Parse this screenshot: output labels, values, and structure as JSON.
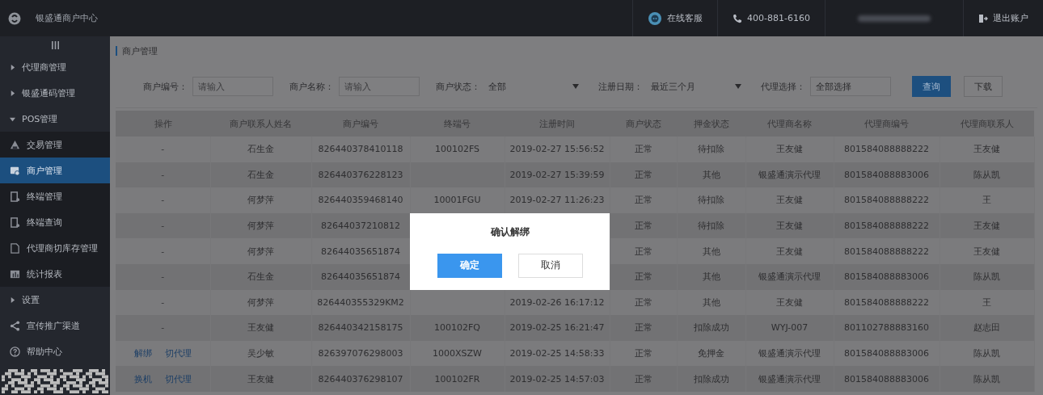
{
  "header": {
    "title": "银盛通商户中心",
    "service": "在线客服",
    "phone": "400-881-6160",
    "logout": "退出账户"
  },
  "sidebar": {
    "items": [
      {
        "kind": "group",
        "label": "代理商管理",
        "expanded": false
      },
      {
        "kind": "group",
        "label": "银盛通码管理",
        "expanded": false
      },
      {
        "kind": "group",
        "label": "POS管理",
        "expanded": true,
        "children": [
          {
            "label": "交易管理",
            "selected": false
          },
          {
            "label": "商户管理",
            "selected": true
          },
          {
            "label": "终端管理",
            "selected": false
          },
          {
            "label": "终端查询",
            "selected": false
          },
          {
            "label": "代理商切库存管理",
            "selected": false
          },
          {
            "label": "统计报表",
            "selected": false
          }
        ]
      },
      {
        "kind": "group",
        "label": "设置",
        "expanded": false
      },
      {
        "kind": "link",
        "label": "宣传推广渠道"
      },
      {
        "kind": "link",
        "label": "帮助中心"
      }
    ]
  },
  "breadcrumb": "商户管理",
  "filters": [
    {
      "kind": "input",
      "label": "商户编号：",
      "placeholder": "请输入"
    },
    {
      "kind": "input",
      "label": "商户名称：",
      "placeholder": "请输入"
    },
    {
      "kind": "select",
      "label": "商户状态：",
      "value": "全部"
    },
    {
      "kind": "select",
      "label": "注册日期：",
      "value": "最近三个月"
    },
    {
      "kind": "input",
      "label": "代理选择：",
      "value": "全部选择"
    }
  ],
  "buttons": [
    {
      "label": "查询",
      "primary": true
    },
    {
      "label": "下载",
      "primary": false
    }
  ],
  "table": {
    "columns": [
      "操作",
      "商户联系人姓名",
      "商户编号",
      "终端号",
      "注册时间",
      "商户状态",
      "押金状态",
      "代理商名称",
      "代理商编号",
      "代理商联系人"
    ],
    "rows": [
      {
        "cells": [
          "-",
          "石生金",
          "826440378410118",
          "100102FS",
          "2019-02-27 15:56:52",
          "正常",
          "待扣除",
          "王友健",
          "801584088888222",
          "王友健"
        ]
      },
      {
        "cells": [
          "-",
          "石生金",
          "826440376228123",
          "",
          "2019-02-27 15:39:59",
          "正常",
          "其他",
          "银盛通演示代理",
          "801584088883006",
          "陈从凯"
        ]
      },
      {
        "cells": [
          "-",
          "何梦萍",
          "826440359468140",
          "10001FGU",
          "2019-02-27 11:26:23",
          "正常",
          "待扣除",
          "王友健",
          "801584088888222",
          "王"
        ]
      },
      {
        "cells": [
          "-",
          "何梦萍",
          "82644037210812",
          "",
          "",
          "正常",
          "待扣除",
          "王友健",
          "801584088888222",
          "王友健"
        ]
      },
      {
        "cells": [
          "-",
          "何梦萍",
          "82644035651874",
          "",
          "",
          "正常",
          "其他",
          "王友健",
          "801584088888222",
          "王友健"
        ]
      },
      {
        "cells": [
          "-",
          "石生金",
          "82644035651874",
          "",
          "",
          "正常",
          "其他",
          "银盛通演示代理",
          "801584088883006",
          "陈从凯"
        ]
      },
      {
        "cells": [
          "-",
          "何梦萍",
          "826440355329KM2",
          "",
          "2019-02-26 16:17:12",
          "正常",
          "其他",
          "王友健",
          "801584088888222",
          "王"
        ]
      },
      {
        "cells": [
          "-",
          "王友健",
          "826440342158175",
          "100102FQ",
          "2019-02-25 16:21:47",
          "正常",
          "扣除成功",
          "WYJ-007",
          "801102788883160",
          "赵志田"
        ]
      },
      {
        "cells": [
          [
            "解绑",
            "切代理"
          ],
          "吴少敏",
          "826397076298003",
          "1000XSZW",
          "2019-02-25 14:58:33",
          "正常",
          "免押金",
          "银盛通演示代理",
          "801584088883006",
          "陈从凯"
        ]
      },
      {
        "cells": [
          [
            "换机",
            "切代理"
          ],
          "王友健",
          "826440376298107",
          "100102FR",
          "2019-02-25 14:57:03",
          "正常",
          "扣除成功",
          "银盛通演示代理",
          "801584088883006",
          "陈从凯"
        ]
      }
    ]
  },
  "dialog": {
    "title": "确认解绑",
    "buttons": [
      {
        "label": "确定",
        "primary": true
      },
      {
        "label": "取消",
        "primary": false
      }
    ]
  }
}
